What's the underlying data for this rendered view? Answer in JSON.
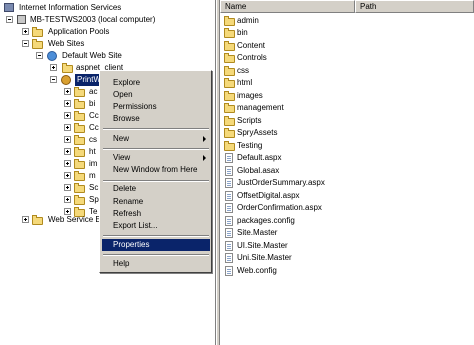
{
  "tree": {
    "root": "Internet Information Services",
    "computer": "MB-TESTWS2003 (local computer)",
    "app_pools": "Application Pools",
    "web_sites": "Web Sites",
    "default_site": "Default Web Site",
    "aspnet_client": "aspnet_client",
    "selected_node": "PrintW",
    "children_partial": [
      "ac",
      "bi",
      "Cc",
      "Cc",
      "cs",
      "ht",
      "im",
      "m",
      "Sc",
      "Sp",
      "Te"
    ],
    "web_service_ext": "Web Service E"
  },
  "list": {
    "columns": [
      "Name",
      "Path"
    ],
    "folders": [
      "admin",
      "bin",
      "Content",
      "Controls",
      "css",
      "html",
      "images",
      "management",
      "Scripts",
      "SpryAssets",
      "Testing"
    ],
    "files": [
      "Default.aspx",
      "Global.asax",
      "JustOrderSummary.aspx",
      "OffsetDigital.aspx",
      "OrderConfirmation.aspx",
      "packages.config",
      "Site.Master",
      "UI.Site.Master",
      "Uni.Site.Master",
      "Web.config"
    ]
  },
  "context_menu": {
    "explore": "Explore",
    "open": "Open",
    "permissions": "Permissions",
    "browse": "Browse",
    "new": "New",
    "view": "View",
    "new_window": "New Window from Here",
    "delete": "Delete",
    "rename": "Rename",
    "refresh": "Refresh",
    "export_list": "Export List...",
    "properties": "Properties",
    "help": "Help"
  },
  "colors": {
    "selection": "#0a246a",
    "menu_bg": "#d4d0c8",
    "folder": "#f5d97a"
  }
}
